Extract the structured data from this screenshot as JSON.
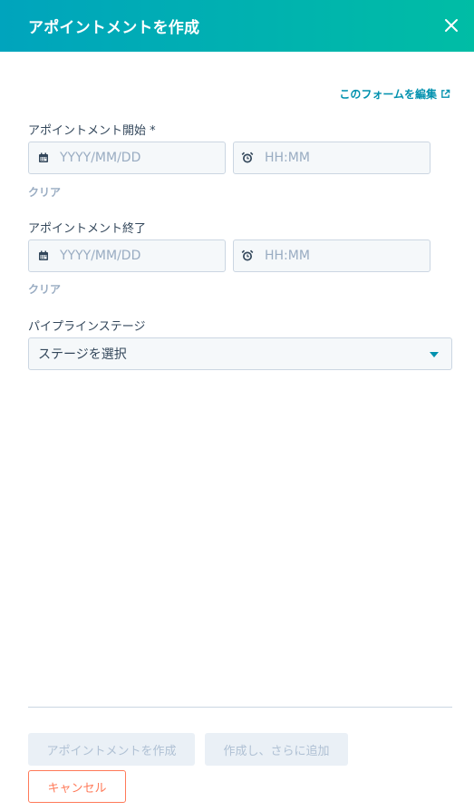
{
  "header": {
    "title": "アポイントメントを作成",
    "close_icon": "close-icon"
  },
  "edit_form_link": {
    "label": "このフォームを編集",
    "icon": "external-link-icon"
  },
  "start": {
    "label": "アポイントメント開始 *",
    "date_placeholder": "YYYY/MM/DD",
    "time_placeholder": "HH:MM",
    "clear_label": "クリア"
  },
  "end": {
    "label": "アポイントメント終了",
    "date_placeholder": "YYYY/MM/DD",
    "time_placeholder": "HH:MM",
    "clear_label": "クリア"
  },
  "pipeline_stage": {
    "label": "パイプラインステージ",
    "selected": "ステージを選択"
  },
  "footer": {
    "create_label": "アポイントメントを作成",
    "create_and_add_label": "作成し、さらに追加",
    "cancel_label": "キャンセル"
  },
  "colors": {
    "header_gradient_start": "#00a4bd",
    "header_gradient_end": "#00bda5",
    "link": "#0091ae",
    "cancel": "#ff7a59"
  }
}
